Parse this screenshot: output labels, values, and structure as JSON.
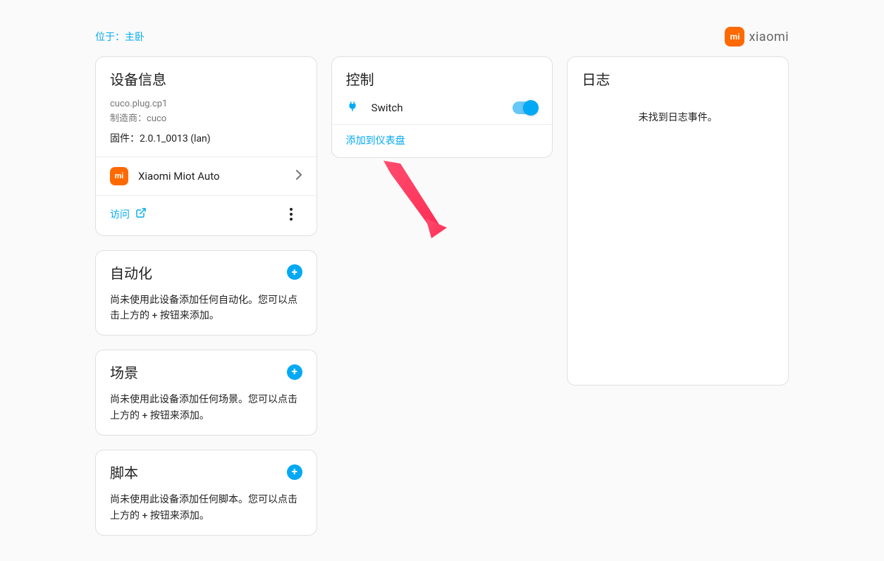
{
  "location": {
    "prefix": "位于：",
    "room": "主卧"
  },
  "brand": {
    "logo_text": "mi",
    "label": "xiaomi"
  },
  "device_info": {
    "title": "设备信息",
    "model": "cuco.plug.cp1",
    "manufacturer_label": "制造商：",
    "manufacturer": "cuco",
    "firmware_label": "固件：",
    "firmware": "2.0.1_0013 (lan)",
    "integration_name": "Xiaomi Miot Auto",
    "visit_label": "访问"
  },
  "automation": {
    "title": "自动化",
    "desc": "尚未使用此设备添加任何自动化。您可以点击上方的 + 按钮来添加。"
  },
  "scene": {
    "title": "场景",
    "desc": "尚未使用此设备添加任何场景。您可以点击上方的 + 按钮来添加。"
  },
  "script": {
    "title": "脚本",
    "desc": "尚未使用此设备添加任何脚本。您可以点击上方的 + 按钮来添加。"
  },
  "control": {
    "title": "控制",
    "switch_label": "Switch",
    "switch_state": true,
    "add_dashboard_label": "添加到仪表盘"
  },
  "log": {
    "title": "日志",
    "empty": "未找到日志事件。"
  }
}
